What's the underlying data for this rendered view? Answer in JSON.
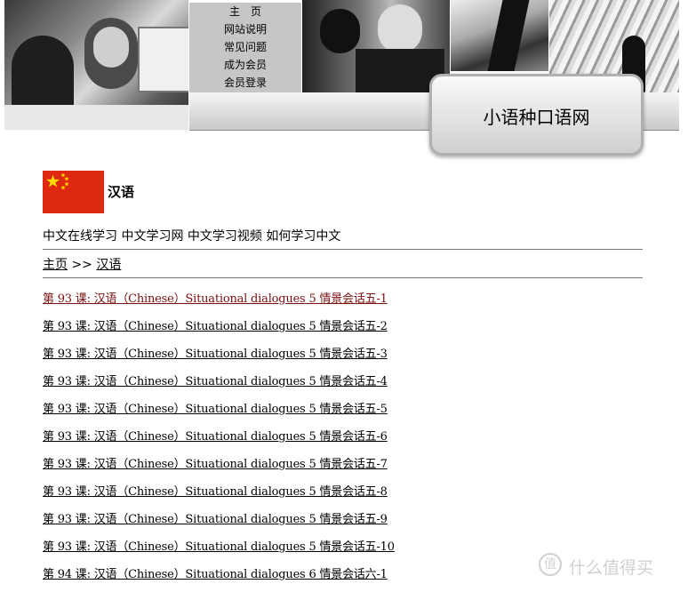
{
  "header": {
    "site_title": "小语种口语网",
    "menu": [
      "主　页",
      "网站说明",
      "常见问题",
      "成为会员",
      "会员登录"
    ]
  },
  "language": {
    "title": "汉语",
    "flag_colors": {
      "field": "#de2910",
      "stars": "#ffde00"
    },
    "tags": "中文在线学习 中文学习网 中文学习视频 如何学习中文"
  },
  "breadcrumb": {
    "home": "主页",
    "separator": ">>",
    "current": "汉语"
  },
  "lessons": [
    "第 93 课: 汉语（Chinese）Situational dialogues 5 情景会话五-1",
    "第 93 课: 汉语（Chinese）Situational dialogues 5 情景会话五-2",
    "第 93 课: 汉语（Chinese）Situational dialogues 5 情景会话五-3",
    "第 93 课: 汉语（Chinese）Situational dialogues 5 情景会话五-4",
    "第 93 课: 汉语（Chinese）Situational dialogues 5 情景会话五-5",
    "第 93 课: 汉语（Chinese）Situational dialogues 5 情景会话五-6",
    "第 93 课: 汉语（Chinese）Situational dialogues 5 情景会话五-7",
    "第 93 课: 汉语（Chinese）Situational dialogues 5 情景会话五-8",
    "第 93 课: 汉语（Chinese）Situational dialogues 5 情景会话五-9",
    "第 93 课: 汉语（Chinese）Situational dialogues 5 情景会话五-10",
    "第 94 课: 汉语（Chinese）Situational dialogues 6 情景会话六-1"
  ],
  "watermark": {
    "icon": "值",
    "text": "什么值得买"
  }
}
